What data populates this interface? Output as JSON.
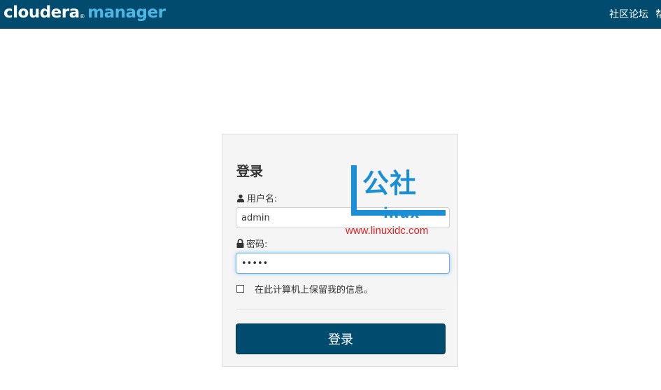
{
  "header": {
    "logo_brand": "cloudera",
    "logo_tm": "®",
    "logo_product": "manager",
    "links": [
      "社区论坛",
      "帮"
    ]
  },
  "login": {
    "title": "登录",
    "username_label": "用户名:",
    "username_value": "admin",
    "password_label": "密码:",
    "password_value": "•••••",
    "remember_label": "在此计算机上保留我的信息。",
    "submit_label": "登录"
  },
  "watermark": {
    "cn_text": "公社",
    "linux_text": "inux",
    "url": "www.linuxidc.com"
  },
  "colors": {
    "header_bg": "#004b6e",
    "product_accent": "#4fb6e3",
    "watermark_blue": "#1a8fd6",
    "watermark_red": "#e02020"
  },
  "icons": {
    "username": "user-icon",
    "password": "lock-icon"
  }
}
